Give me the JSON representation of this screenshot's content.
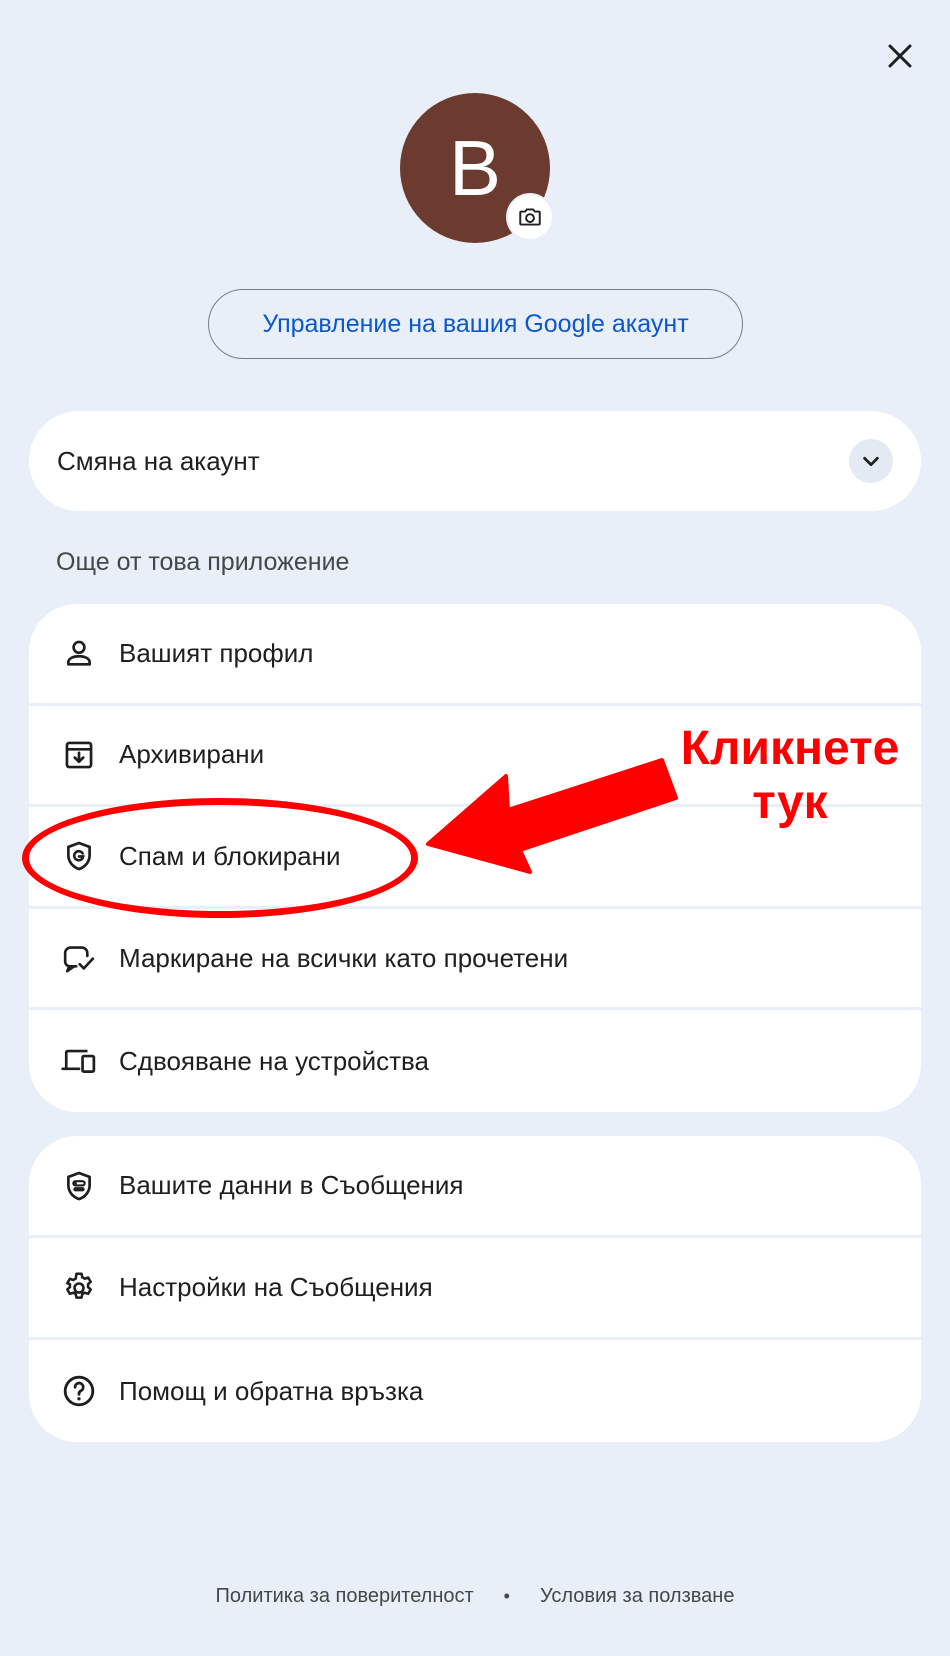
{
  "close_icon": "close-icon",
  "avatar": {
    "letter": "B",
    "color": "#6a3b2e",
    "badge_icon": "camera-icon"
  },
  "manage_account_label": "Управление на вашия Google акаунт",
  "switch_account": {
    "label": "Смяна на акаунт",
    "icon": "chevron-down-icon"
  },
  "section_title": "Още от това приложение",
  "menu1": [
    {
      "label": "Вашият профил",
      "icon": "person-icon"
    },
    {
      "label": "Архивирани",
      "icon": "archive-icon"
    },
    {
      "label": "Спам и блокирани",
      "icon": "shield-g-icon"
    },
    {
      "label": "Маркиране на всички като прочетени",
      "icon": "mark-read-icon"
    },
    {
      "label": "Сдвояване на устройства",
      "icon": "devices-icon"
    }
  ],
  "menu2": [
    {
      "label": "Вашите данни в Съобщения",
      "icon": "privacy-shield-icon"
    },
    {
      "label": "Настройки на Съобщения",
      "icon": "gear-icon"
    },
    {
      "label": "Помощ и обратна връзка",
      "icon": "help-icon"
    }
  ],
  "annotation": {
    "line1": "Кликнете",
    "line2": "тук",
    "color": "#ff0000"
  },
  "footer": {
    "privacy": "Политика за поверителност",
    "separator": "•",
    "terms": "Условия за ползване"
  }
}
